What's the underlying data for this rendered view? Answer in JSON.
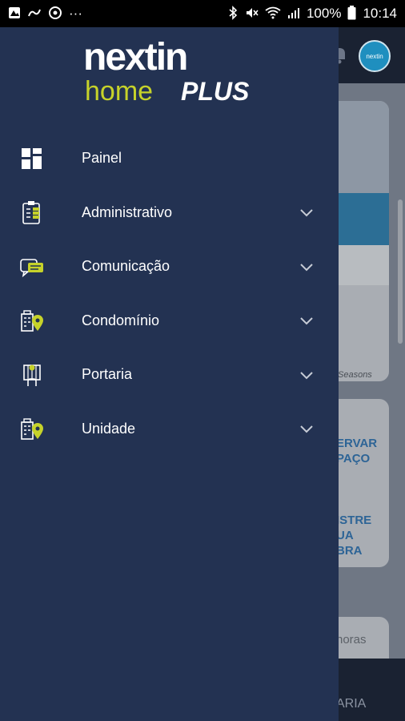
{
  "status_bar": {
    "left_icons": [
      "image-icon",
      "link-icon",
      "sync-icon"
    ],
    "more": "···",
    "battery": "100%",
    "time": "10:14"
  },
  "background_app": {
    "avatar_text": "nextin",
    "card_caption": "Seasons",
    "actions": [
      {
        "line1": "ERVAR",
        "line2": "PAÇO"
      },
      {
        "line1": "ISTRE",
        "line2": "UA",
        "line3": "BRA"
      }
    ],
    "partial_text": "noras",
    "bottom_nav_label": "ARIA"
  },
  "logo": {
    "word1": "nextin",
    "word2": "home",
    "word3": "PLUS"
  },
  "menu": {
    "items": [
      {
        "label": "Painel",
        "icon": "dashboard-icon",
        "expandable": false
      },
      {
        "label": "Administrativo",
        "icon": "clipboard-icon",
        "expandable": true
      },
      {
        "label": "Comunicação",
        "icon": "chat-icon",
        "expandable": true
      },
      {
        "label": "Condomínio",
        "icon": "building-pin-icon",
        "expandable": true
      },
      {
        "label": "Portaria",
        "icon": "gate-icon",
        "expandable": true
      },
      {
        "label": "Unidade",
        "icon": "unit-pin-icon",
        "expandable": true
      }
    ]
  },
  "colors": {
    "drawer_bg": "#233252",
    "accent": "#c6d22a",
    "text": "#ffffff"
  }
}
